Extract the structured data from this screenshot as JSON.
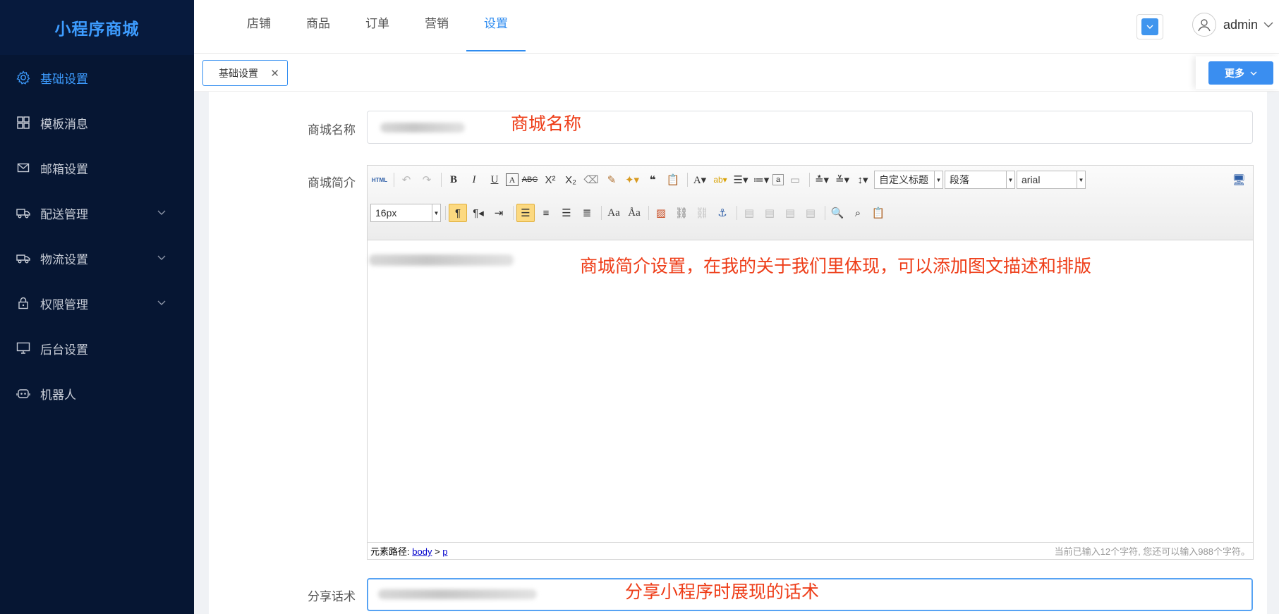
{
  "brand": "小程序商城",
  "sidebar": {
    "items": [
      {
        "label": "基础设置",
        "icon": "gear-icon",
        "active": true
      },
      {
        "label": "模板消息",
        "icon": "grid-icon"
      },
      {
        "label": "邮箱设置",
        "icon": "mail-icon"
      },
      {
        "label": "配送管理",
        "icon": "truck-icon",
        "expandable": true
      },
      {
        "label": "物流设置",
        "icon": "logistics-icon",
        "expandable": true
      },
      {
        "label": "权限管理",
        "icon": "lock-icon",
        "expandable": true
      },
      {
        "label": "后台设置",
        "icon": "monitor-icon"
      },
      {
        "label": "机器人",
        "icon": "robot-icon"
      }
    ]
  },
  "topnav": {
    "tabs": [
      "店铺",
      "商品",
      "订单",
      "营销",
      "设置"
    ],
    "active": "设置"
  },
  "user": {
    "name": "admin"
  },
  "tags": {
    "current": "基础设置",
    "more_label": "更多"
  },
  "form": {
    "shop_name": {
      "label": "商城名称",
      "note": "商城名称"
    },
    "shop_intro": {
      "label": "商城简介",
      "note": "商城简介设置，在我的关于我们里体现，可以添加图文描述和排版"
    },
    "share_text": {
      "label": "分享话术",
      "note": "分享小程序时展现的话术"
    }
  },
  "editor": {
    "toolbar": {
      "html_label": "HTML",
      "heading_select": "自定义标题",
      "paragraph_select": "段落",
      "font_select": "arial",
      "size_select": "16px"
    },
    "path_label": "元素路径:",
    "path_body": "body",
    "path_sep": ">",
    "path_p": "p",
    "char_count": "当前已输入12个字符, 您还可以输入988个字符。"
  },
  "colors": {
    "sidebar_bg": "#061633",
    "accent": "#2f8cf0",
    "note_red": "#ee3d18"
  }
}
